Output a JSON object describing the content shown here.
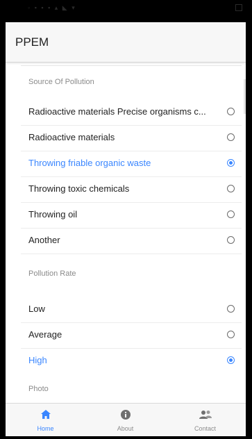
{
  "app": {
    "title": "PPEM"
  },
  "source_section": {
    "header": "Source Of Pollution",
    "options": [
      {
        "label": "Radioactive materials Precise organisms c...",
        "selected": false
      },
      {
        "label": "Radioactive materials",
        "selected": false
      },
      {
        "label": "Throwing friable organic waste",
        "selected": true
      },
      {
        "label": "Throwing toxic chemicals",
        "selected": false
      },
      {
        "label": "Throwing oil",
        "selected": false
      },
      {
        "label": "Another",
        "selected": false
      }
    ]
  },
  "rate_section": {
    "header": "Pollution Rate",
    "options": [
      {
        "label": "Low",
        "selected": false
      },
      {
        "label": "Average",
        "selected": false
      },
      {
        "label": "High",
        "selected": true
      }
    ]
  },
  "photo_section": {
    "header": "Photo"
  },
  "tabs": [
    {
      "label": "Home",
      "icon": "home-icon",
      "active": true
    },
    {
      "label": "About",
      "icon": "info-icon",
      "active": false
    },
    {
      "label": "Contact",
      "icon": "contacts-icon",
      "active": false
    }
  ],
  "colors": {
    "accent": "#3a86ff",
    "text": "#222222",
    "muted": "#8a8a8a",
    "bar": "#f7f7f7"
  }
}
